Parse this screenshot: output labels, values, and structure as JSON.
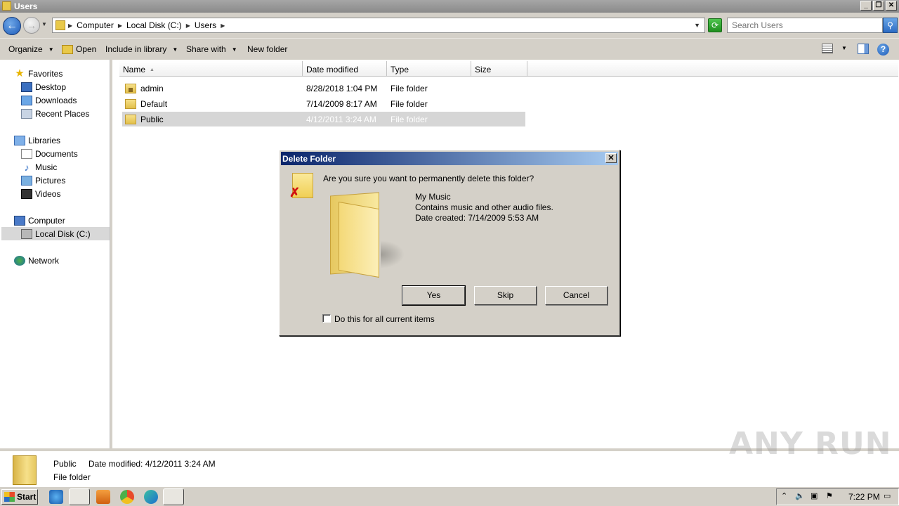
{
  "window": {
    "title": "Users"
  },
  "address": {
    "crumbs": [
      "Computer",
      "Local Disk (C:)",
      "Users"
    ],
    "search_placeholder": "Search Users"
  },
  "toolbar": {
    "organize": "Organize",
    "open": "Open",
    "include_in_library": "Include in library",
    "share_with": "Share with",
    "new_folder": "New folder"
  },
  "nav": {
    "favorites": "Favorites",
    "desktop": "Desktop",
    "downloads": "Downloads",
    "recent_places": "Recent Places",
    "libraries": "Libraries",
    "documents": "Documents",
    "music": "Music",
    "pictures": "Pictures",
    "videos": "Videos",
    "computer": "Computer",
    "local_disk": "Local Disk (C:)",
    "network": "Network"
  },
  "columns": {
    "name": "Name",
    "date_modified": "Date modified",
    "type": "Type",
    "size": "Size"
  },
  "files": [
    {
      "name": "admin",
      "date": "8/28/2018 1:04 PM",
      "type": "File folder"
    },
    {
      "name": "Default",
      "date": "7/14/2009 8:17 AM",
      "type": "File folder"
    },
    {
      "name": "Public",
      "date": "4/12/2011 3:24 AM",
      "type": "File folder"
    }
  ],
  "details": {
    "name": "Public",
    "date_label": "Date modified: 4/12/2011 3:24 AM",
    "type": "File folder"
  },
  "watermark": "ANY RUN",
  "dialog": {
    "title": "Delete Folder",
    "question": "Are you sure you want to permanently delete this folder?",
    "item_name": "My Music",
    "item_desc": "Contains music and other audio files.",
    "item_created": "Date created: 7/14/2009 5:53 AM",
    "yes": "Yes",
    "skip": "Skip",
    "cancel": "Cancel",
    "apply_all": "Do this for all current items"
  },
  "taskbar": {
    "start": "Start",
    "clock": "7:22 PM"
  }
}
